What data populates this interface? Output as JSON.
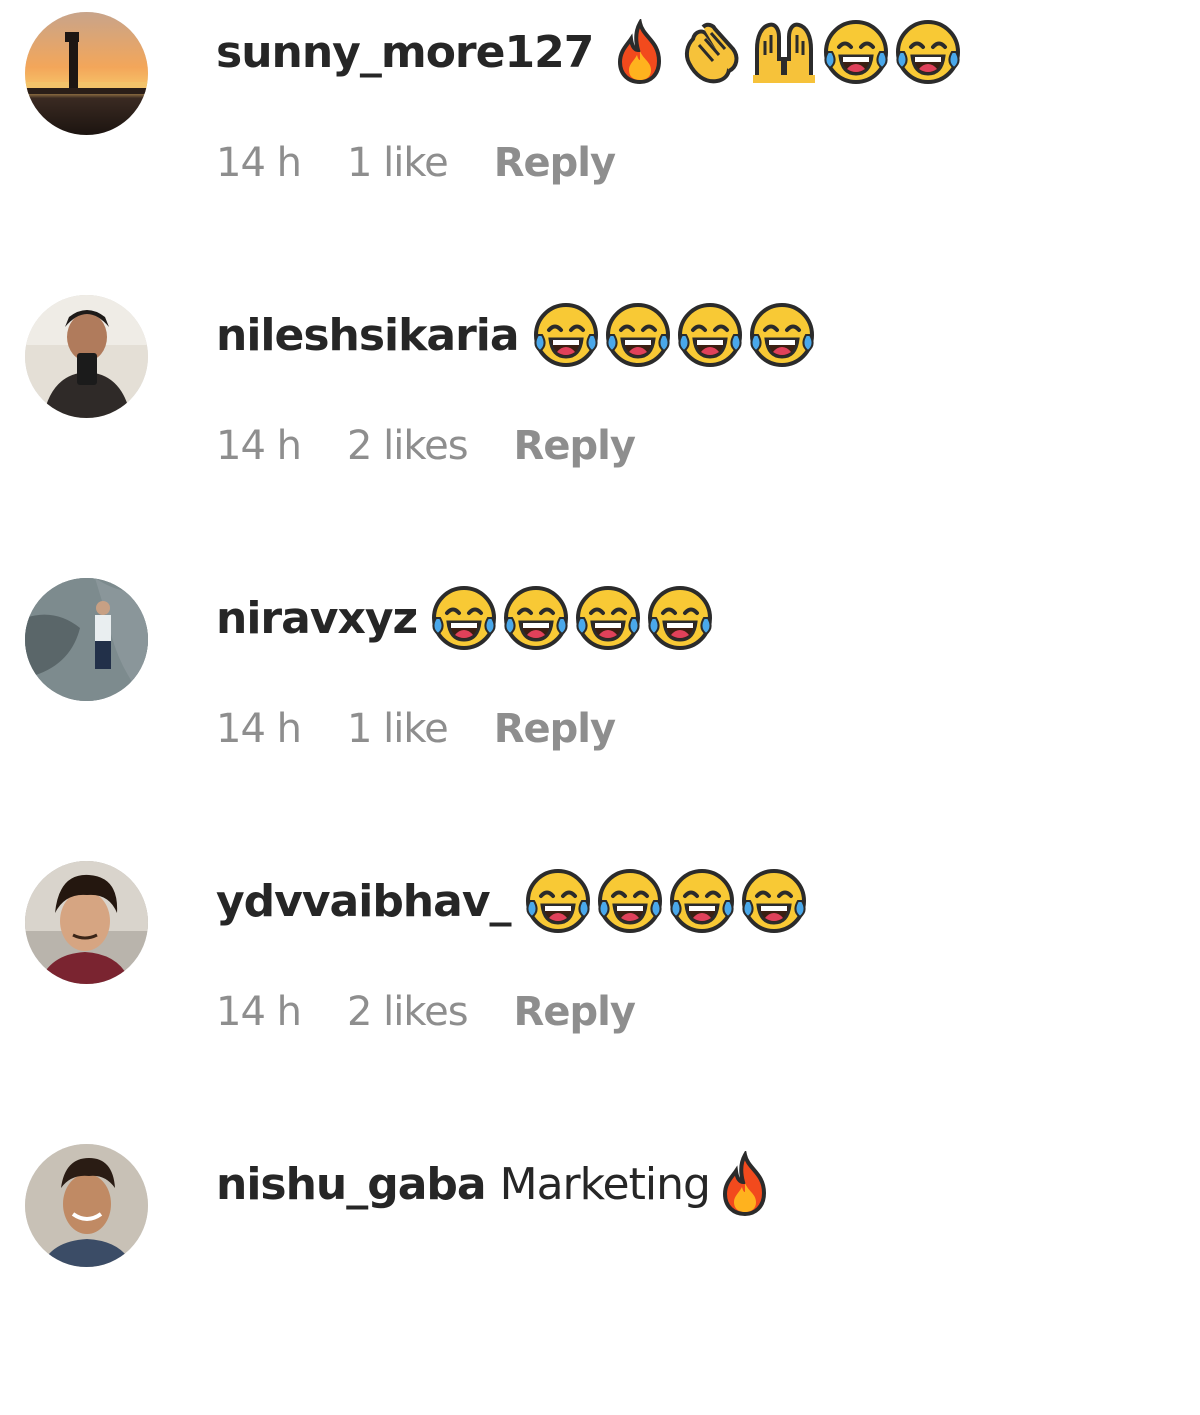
{
  "comments": [
    {
      "username": "sunny_more127",
      "text": "",
      "emojis": [
        "fire-emoji",
        "clapping-hands-emoji",
        "raising-hands-emoji",
        "tears-of-joy-emoji",
        "tears-of-joy-emoji"
      ],
      "time": "14 h",
      "likes": "1 like",
      "reply": "Reply",
      "avatar": "sunset-avatar"
    },
    {
      "username": "nileshsikaria",
      "text": "",
      "emojis": [
        "tears-of-joy-emoji",
        "tears-of-joy-emoji",
        "tears-of-joy-emoji",
        "tears-of-joy-emoji"
      ],
      "time": "14 h",
      "likes": "2 likes",
      "reply": "Reply",
      "avatar": "selfie-avatar"
    },
    {
      "username": "niravxyz",
      "text": "",
      "emojis": [
        "tears-of-joy-emoji",
        "tears-of-joy-emoji",
        "tears-of-joy-emoji",
        "tears-of-joy-emoji"
      ],
      "time": "14 h",
      "likes": "1 like",
      "reply": "Reply",
      "avatar": "rock-avatar"
    },
    {
      "username": "ydvvaibhav_",
      "text": "",
      "emojis": [
        "tears-of-joy-emoji",
        "tears-of-joy-emoji",
        "tears-of-joy-emoji",
        "tears-of-joy-emoji"
      ],
      "time": "14 h",
      "likes": "2 likes",
      "reply": "Reply",
      "avatar": "portrait-avatar"
    },
    {
      "username": "nishu_gaba",
      "text": "Marketing",
      "emojis": [
        "fire-emoji"
      ],
      "avatar": "smiling-avatar"
    }
  ]
}
